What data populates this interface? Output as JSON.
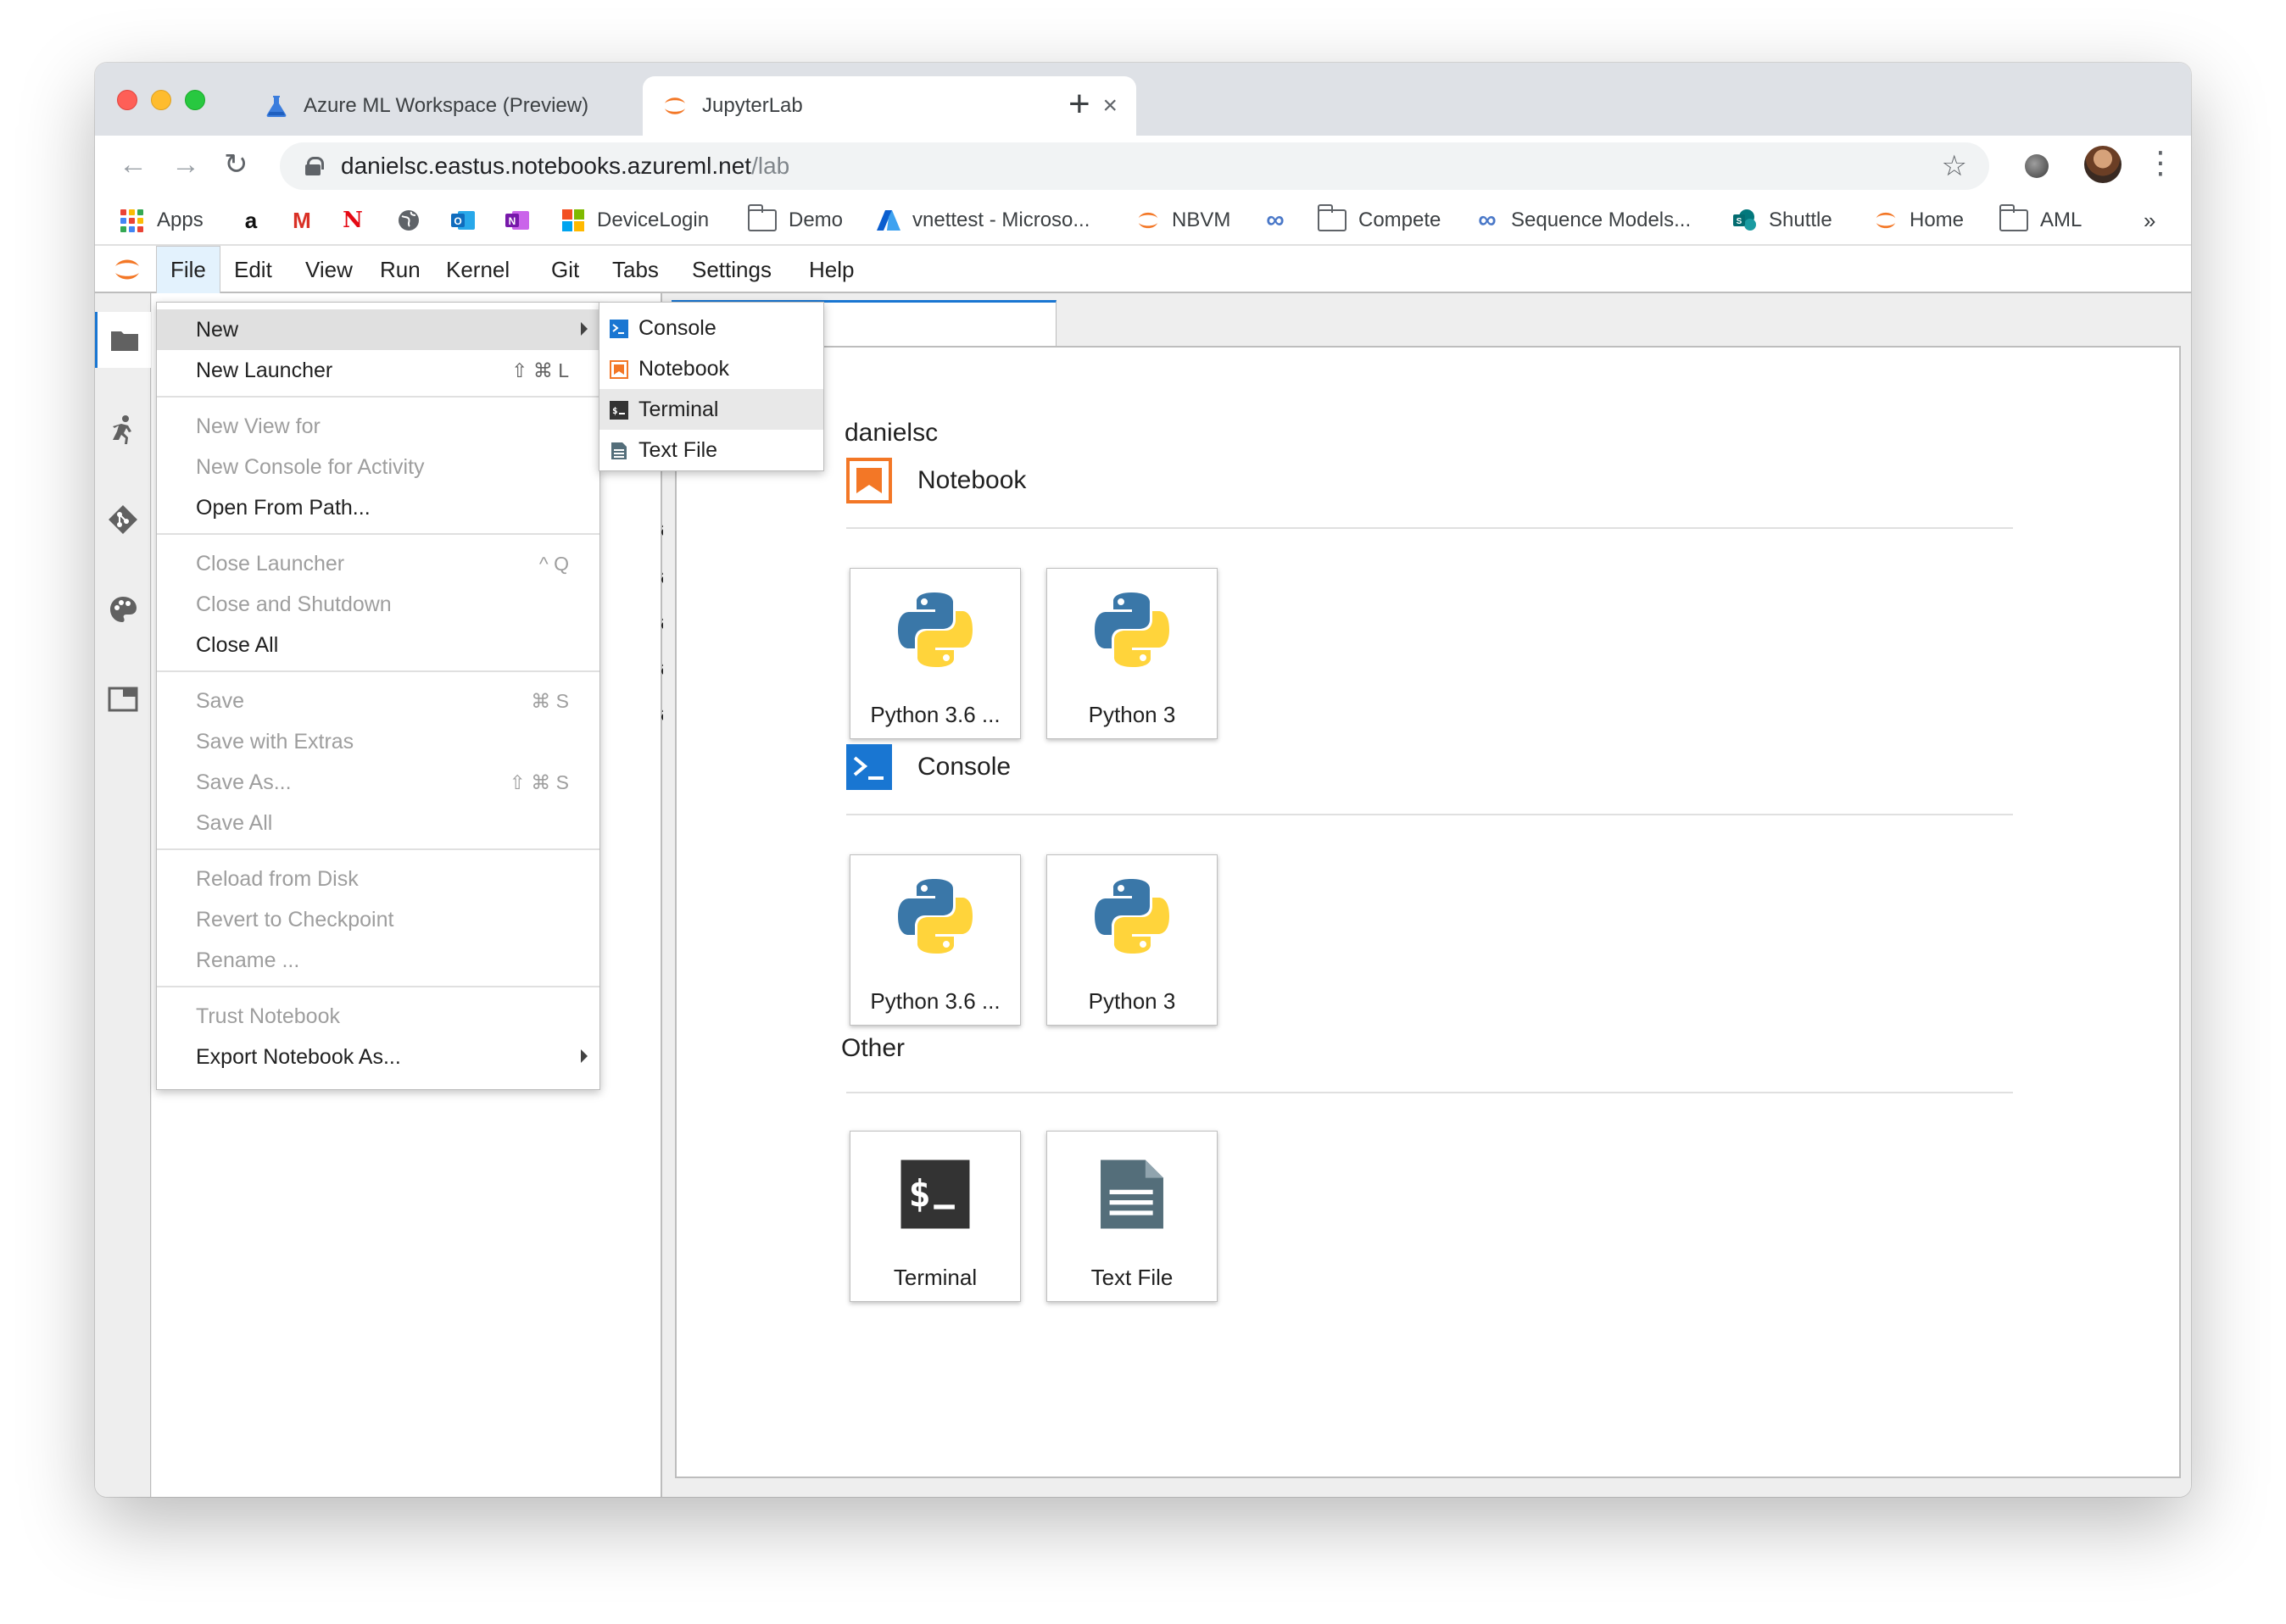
{
  "browser": {
    "tabs": [
      {
        "title": "Azure ML Workspace (Preview)"
      },
      {
        "title": "JupyterLab"
      }
    ],
    "url": {
      "host": "danielsc.eastus.notebooks.azureml.net",
      "path": "/lab"
    },
    "bookmarks": [
      {
        "label": "Apps",
        "icon": "apps-grid-icon"
      },
      {
        "label": "",
        "icon": "amazon-icon"
      },
      {
        "label": "",
        "icon": "gmail-icon"
      },
      {
        "label": "",
        "icon": "netflix-icon"
      },
      {
        "label": "",
        "icon": "globe-icon"
      },
      {
        "label": "",
        "icon": "outlook-icon"
      },
      {
        "label": "",
        "icon": "onenote-icon"
      },
      {
        "label": "DeviceLogin",
        "icon": "microsoft-icon"
      },
      {
        "label": "Demo",
        "icon": "folder-icon"
      },
      {
        "label": "vnettest - Microso...",
        "icon": "azure-icon"
      },
      {
        "label": "NBVM",
        "icon": "jupyter-icon"
      },
      {
        "label": "",
        "icon": "infinity-icon"
      },
      {
        "label": "Compete",
        "icon": "folder-icon"
      },
      {
        "label": "Sequence Models...",
        "icon": "infinity-icon"
      },
      {
        "label": "Shuttle",
        "icon": "sharepoint-icon"
      },
      {
        "label": "Home",
        "icon": "jupyter-icon"
      },
      {
        "label": "AML",
        "icon": "folder-icon"
      }
    ],
    "overflow": "»"
  },
  "jupyter": {
    "menubar": [
      "File",
      "Edit",
      "View",
      "Run",
      "Kernel",
      "Git",
      "Tabs",
      "Settings",
      "Help"
    ],
    "file_menu": {
      "new": "New",
      "new_launcher": "New Launcher",
      "new_launcher_sc": "⇧ ⌘ L",
      "new_view": "New View for",
      "new_console_activity": "New Console for Activity",
      "open_from_path": "Open From Path...",
      "close_launcher": "Close Launcher",
      "close_launcher_sc": "^ Q",
      "close_shutdown": "Close and Shutdown",
      "close_all": "Close All",
      "save": "Save",
      "save_sc": "⌘ S",
      "save_extras": "Save with Extras",
      "save_as": "Save As...",
      "save_as_sc": "⇧ ⌘ S",
      "save_all": "Save All",
      "reload": "Reload from Disk",
      "revert": "Revert to Checkpoint",
      "rename": "Rename ...",
      "trust": "Trust Notebook",
      "export": "Export Notebook As..."
    },
    "new_submenu": [
      "Console",
      "Notebook",
      "Terminal",
      "Text File"
    ],
    "file_browser_ago": [
      "ago",
      "ago",
      "ago",
      "ago",
      "ago"
    ],
    "launcher": {
      "user": "danielsc",
      "sections": {
        "notebook": {
          "title": "Notebook",
          "cards": [
            "Python 3.6 ...",
            "Python 3"
          ]
        },
        "console": {
          "title": "Console",
          "cards": [
            "Python 3.6 ...",
            "Python 3"
          ]
        },
        "other": {
          "title": "Other",
          "cards": [
            "Terminal",
            "Text File"
          ]
        }
      }
    }
  },
  "colors": {
    "jupyter_orange": "#f37726",
    "console_blue": "#1976d2",
    "python_blue": "#3a77a8",
    "python_yellow": "#ffd43b",
    "terminal_dark": "#333333",
    "textfile_gray": "#546e7a"
  }
}
